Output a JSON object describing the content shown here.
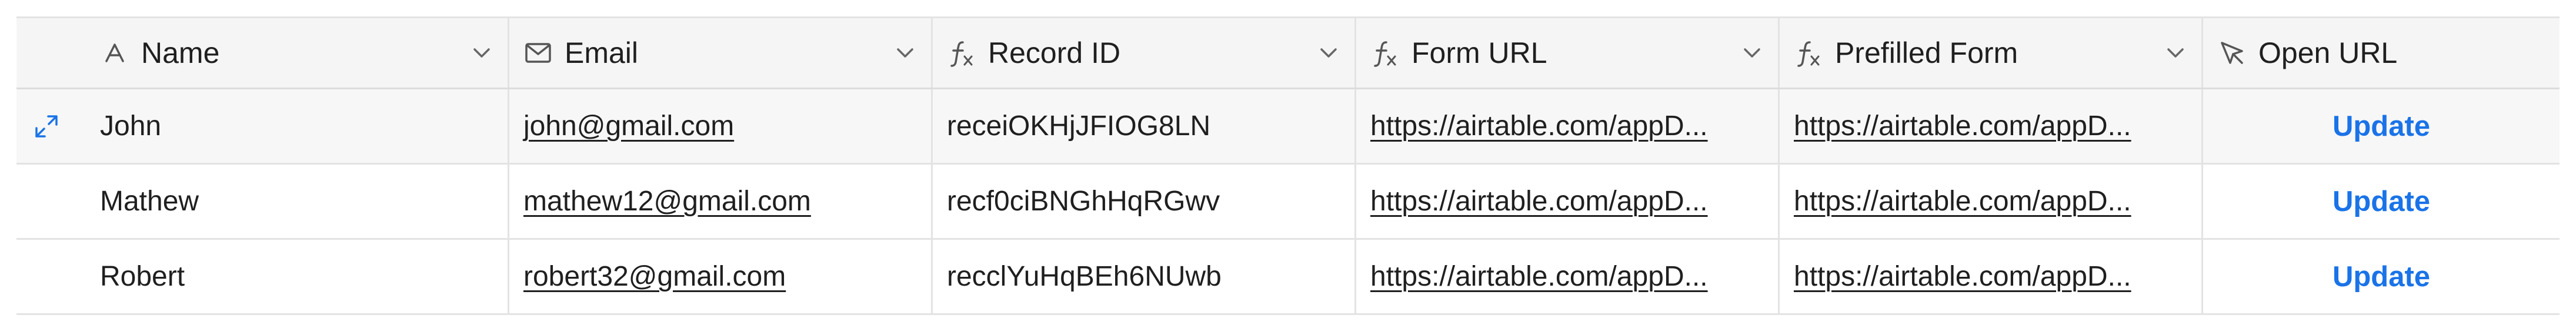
{
  "columns": [
    {
      "label": "Name",
      "icon": "text-field-icon"
    },
    {
      "label": "Email",
      "icon": "email-field-icon"
    },
    {
      "label": "Record ID",
      "icon": "formula-icon"
    },
    {
      "label": "Form URL",
      "icon": "formula-icon"
    },
    {
      "label": "Prefilled Form",
      "icon": "formula-icon"
    },
    {
      "label": "Open URL",
      "icon": "button-field-icon"
    }
  ],
  "rows": [
    {
      "name": "John",
      "email": "john@gmail.com",
      "record_id": "receiOKHjJFIOG8LN",
      "form_url": "https://airtable.com/appD...",
      "prefilled_form": "https://airtable.com/appD...",
      "open_url": "Update"
    },
    {
      "name": "Mathew",
      "email": "mathew12@gmail.com",
      "record_id": "recf0ciBNGhHqRGwv",
      "form_url": "https://airtable.com/appD...",
      "prefilled_form": "https://airtable.com/appD...",
      "open_url": "Update"
    },
    {
      "name": "Robert",
      "email": "robert32@gmail.com",
      "record_id": "recclYuHqBEh6NUwb",
      "form_url": "https://airtable.com/appD...",
      "prefilled_form": "https://airtable.com/appD...",
      "open_url": "Update"
    }
  ],
  "colors": {
    "button_text": "#1a73e8",
    "expand_icon": "#1a73e8",
    "header_bg": "#f5f5f5",
    "border": "#e3e3e3"
  }
}
